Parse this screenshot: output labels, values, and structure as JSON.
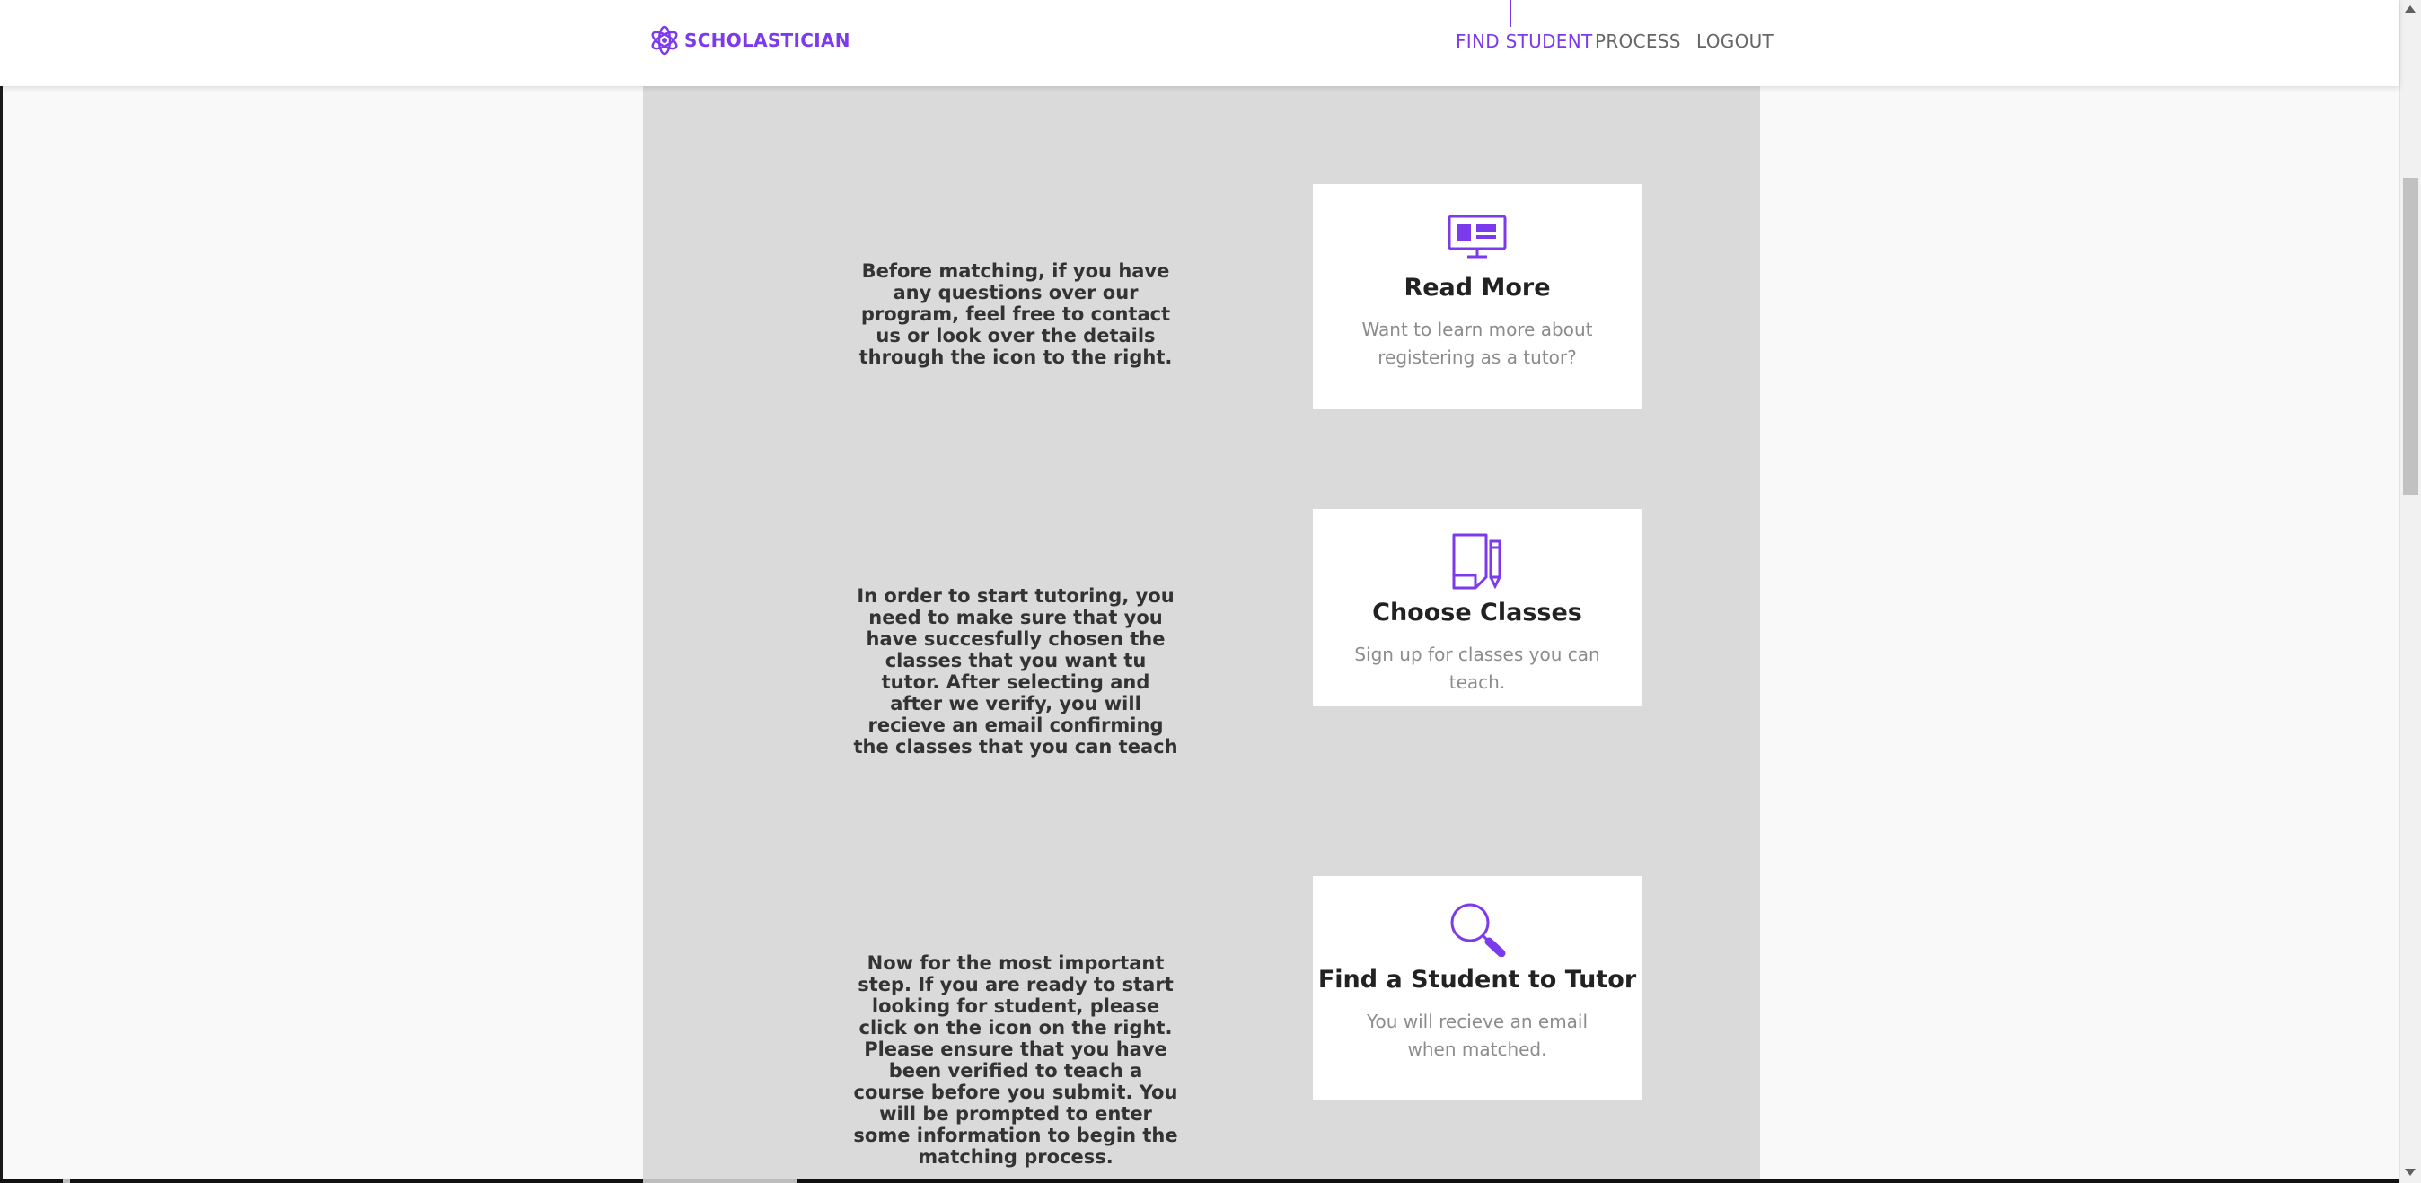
{
  "header": {
    "logo_text": "SCHOLASTICIAN",
    "nav": [
      {
        "label": "FIND STUDENT",
        "active": true
      },
      {
        "label": "PROCESS",
        "active": false
      },
      {
        "label": "LOGOUT",
        "active": false
      }
    ]
  },
  "colors": {
    "accent": "#7c3aed",
    "panel": "#dadada",
    "background": "#f9f9f9"
  },
  "steps": [
    {
      "description": "Before matching, if you have any questions over our program, feel free to contact us or look over the details through the icon to the right.",
      "card": {
        "icon": "monitor-icon",
        "title": "Read More",
        "subtitle": "Want to learn more about registering as a tutor?"
      }
    },
    {
      "description": "In order to start tutoring, you need to make sure that you have succesfully chosen the classes that you want tu tutor. After selecting and after we verify, you will recieve an email confirming the classes that you can teach",
      "card": {
        "icon": "document-pencil-icon",
        "title": "Choose Classes",
        "subtitle": "Sign up for classes you can teach."
      }
    },
    {
      "description": "Now for the most important step. If you are ready to start looking for student, please click on the icon on the right. Please ensure that you have been verified to teach a course before you submit. You will be prompted to enter some information to begin the matching process.",
      "card": {
        "icon": "magnifier-icon",
        "title": "Find a Student to Tutor",
        "subtitle": "You will recieve an email when matched."
      }
    }
  ]
}
